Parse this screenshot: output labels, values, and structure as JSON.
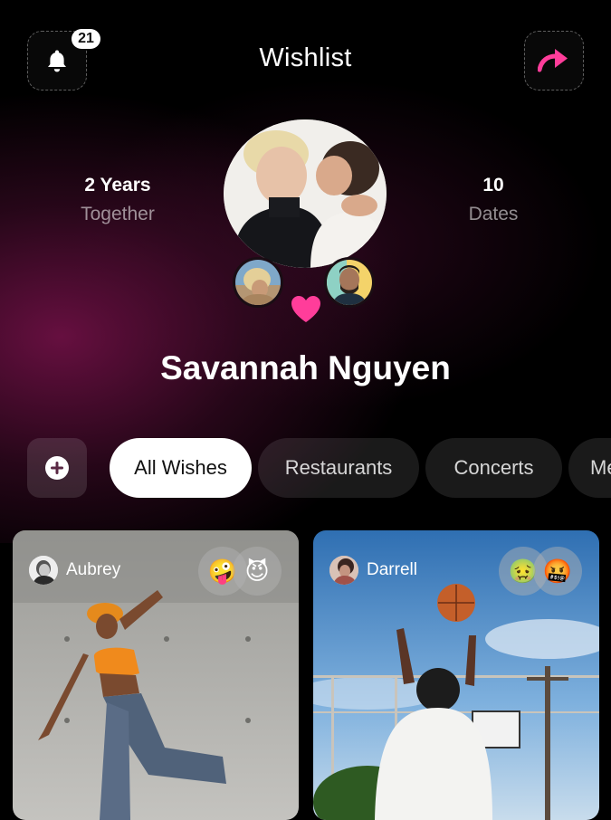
{
  "header": {
    "title": "Wishlist",
    "notification_count": "21",
    "bell_icon": "bell-icon",
    "share_icon": "share-arrow-icon"
  },
  "profile": {
    "stats": [
      {
        "value": "2 Years",
        "label": "Together"
      },
      {
        "value": "10",
        "label": "Dates"
      }
    ],
    "name": "Savannah Nguyen",
    "heart_color": "#ff3d9a"
  },
  "filters": {
    "add_icon": "plus-icon",
    "chips": [
      "All Wishes",
      "Restaurants",
      "Concerts",
      "Me"
    ],
    "active_index": 0
  },
  "cards": [
    {
      "user": "Aubrey",
      "reactions": [
        "🤪",
        "😈"
      ]
    },
    {
      "user": "Darrell",
      "reactions": [
        "🤢",
        "🤬"
      ]
    }
  ],
  "colors": {
    "accent_pink": "#ff3d9a",
    "background": "#000000",
    "active_chip": "#ffffff"
  }
}
